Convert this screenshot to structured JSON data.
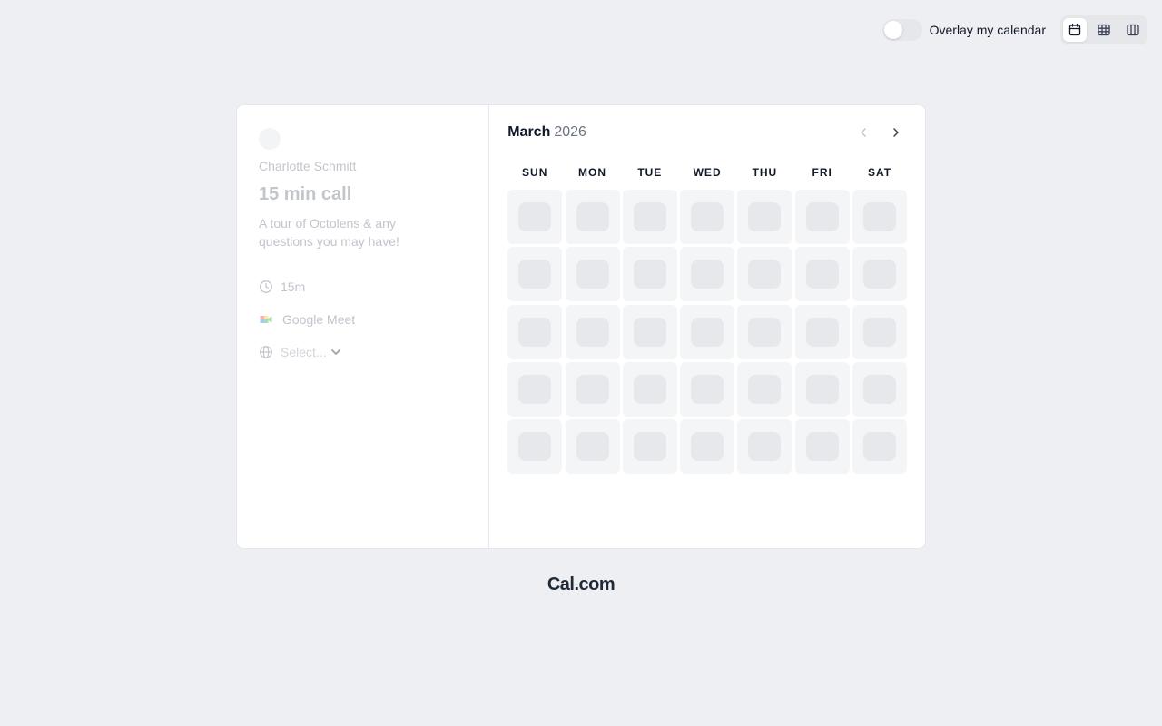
{
  "topbar": {
    "overlay_label": "Overlay my calendar",
    "overlay_enabled": false,
    "views": [
      {
        "name": "month-view",
        "icon": "calendar-icon",
        "active": true
      },
      {
        "name": "week-view",
        "icon": "grid-icon",
        "active": false
      },
      {
        "name": "column-view",
        "icon": "columns-icon",
        "active": false
      }
    ]
  },
  "event": {
    "host_name": "Charlotte Schmitt",
    "title": "15 min call",
    "description": "A tour of Octolens & any questions you may have!",
    "duration": "15m",
    "location": "Google Meet",
    "timezone_placeholder": "Select..."
  },
  "calendar": {
    "month": "March",
    "year": "2026",
    "weekdays": [
      "SUN",
      "MON",
      "TUE",
      "WED",
      "THU",
      "FRI",
      "SAT"
    ],
    "rows": 5,
    "loading": true
  },
  "footer": {
    "brand": "Cal.com"
  },
  "colors": {
    "background": "#eeeff2",
    "card": "#ffffff",
    "muted_text": "#c2c5cc",
    "skeleton": "#e7e8eb"
  }
}
